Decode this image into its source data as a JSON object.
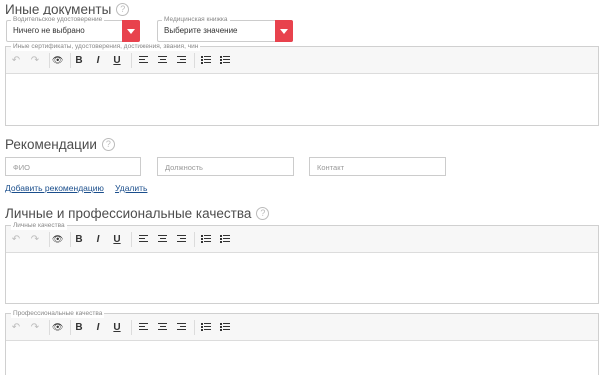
{
  "sections": {
    "other_docs": {
      "title": "Иные документы",
      "help": "?"
    },
    "recommendations": {
      "title": "Рекомендации",
      "help": "?"
    },
    "qualities": {
      "title": "Личные и профессиональные качества",
      "help": "?"
    }
  },
  "selects": {
    "driver_license": {
      "legend": "Водительское удостоверение",
      "value": "Ничего не выбрано"
    },
    "medical_book": {
      "legend": "Медицинская книжка",
      "value": "Выберите значение"
    }
  },
  "editors": {
    "certificates": {
      "legend": "Иные сертификаты, удостоверения, достижения, звания, чин"
    },
    "personal": {
      "legend": "Личные качества"
    },
    "professional": {
      "legend": "Профессиональные качества"
    }
  },
  "toolbar": {
    "undo": "↶",
    "redo": "↷",
    "preview": "👁",
    "bold": "B",
    "italic": "I",
    "underline": "U",
    "num_list": "1 2 3"
  },
  "recommend_inputs": {
    "name_ph": "ФИО",
    "position_ph": "Должность",
    "contact_ph": "Контакт"
  },
  "links": {
    "add": "Добавить рекомендацию",
    "delete": "Удалить"
  },
  "colors": {
    "accent": "#e8424d",
    "link": "#1a4e8c"
  }
}
